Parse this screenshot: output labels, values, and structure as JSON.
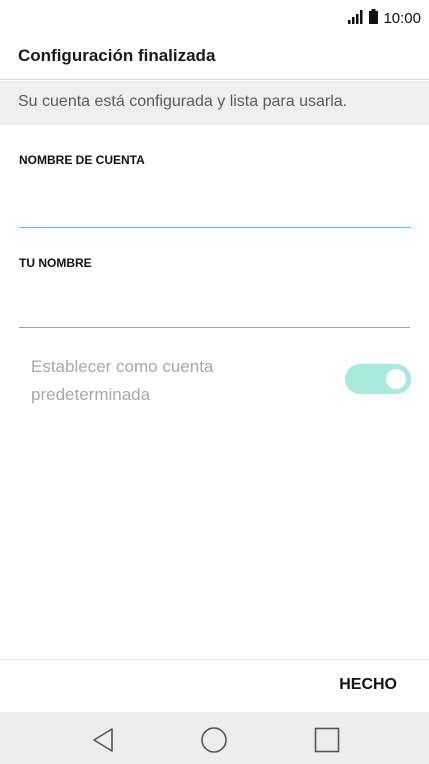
{
  "status_bar": {
    "time": "10:00",
    "icons": [
      "signal-icon",
      "battery-icon"
    ]
  },
  "header": {
    "title": "Configuración finalizada"
  },
  "banner": {
    "message": "Su cuenta está configurada y lista para usarla."
  },
  "form": {
    "account_name": {
      "label": "NOMBRE DE CUENTA",
      "value": ""
    },
    "your_name": {
      "label": "TU NOMBRE",
      "value": ""
    },
    "default_account": {
      "label": "Establecer como cuenta predeterminada",
      "enabled": true,
      "disabled_appearance": true
    }
  },
  "footer": {
    "done_label": "HECHO"
  },
  "nav_bar": {
    "buttons": [
      "back-icon",
      "home-icon",
      "recents-icon"
    ]
  },
  "colors": {
    "accent": "#53d1c0",
    "toggle_track": "#a9e9df",
    "banner_bg": "#efefef",
    "nav_bg": "#ededed"
  }
}
